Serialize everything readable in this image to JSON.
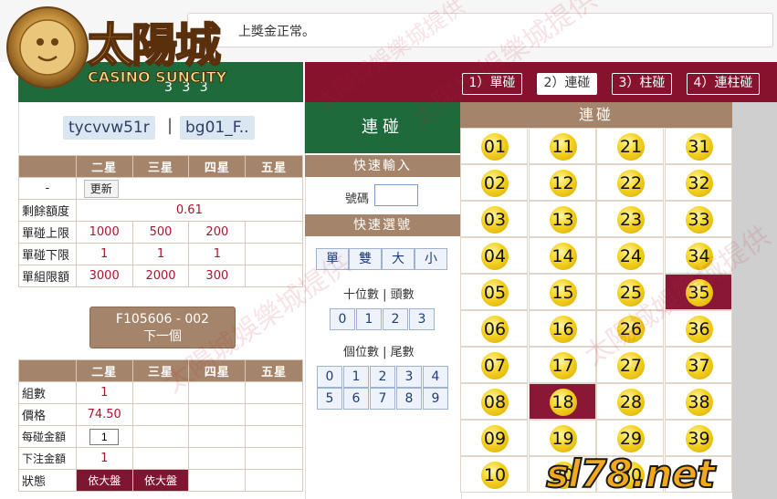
{
  "marquee_text": "上獎金正常。",
  "logo": {
    "brand_cn": "太陽城",
    "brand_en": "CASINO SUNCITY"
  },
  "left_header_code": "3 3 3",
  "play_tabs": [
    {
      "label": "1）單碰"
    },
    {
      "label": "2）連碰"
    },
    {
      "label": "3）柱碰"
    },
    {
      "label": "4）連柱碰"
    }
  ],
  "user": {
    "account": "tycvvw51r",
    "separator": "|",
    "game_id": "bg01_F.."
  },
  "limits_table": {
    "headers": [
      "二星",
      "三星",
      "四星",
      "五星"
    ],
    "refresh_row": {
      "label": "-",
      "button": "更新"
    },
    "balance": {
      "label": "剩餘額度",
      "value": "0.61"
    },
    "rows": [
      {
        "label": "單碰上限",
        "values": [
          "1000",
          "500",
          "200",
          ""
        ]
      },
      {
        "label": "單碰下限",
        "values": [
          "1",
          "1",
          "1",
          ""
        ]
      },
      {
        "label": "單組限額",
        "values": [
          "3000",
          "2000",
          "300",
          ""
        ]
      }
    ]
  },
  "next_button": {
    "line1": "F105606 - 002",
    "line2": "下一個"
  },
  "bet_table": {
    "headers": [
      "二星",
      "三星",
      "四星",
      "五星"
    ],
    "groups": {
      "label": "組數",
      "value": "1"
    },
    "price": {
      "label": "價格",
      "value": "74.50"
    },
    "per_bet": {
      "label": "每碰金額",
      "value": "1"
    },
    "total": {
      "label": "下注金額",
      "value": "1"
    },
    "status": {
      "label": "狀態",
      "values": [
        "依大盤",
        "依大盤"
      ]
    }
  },
  "middle": {
    "title": "連碰",
    "quick_input": "快速輸入",
    "number_label": "號碼",
    "number_value": "",
    "quick_select": "快速選號",
    "parity_buttons": [
      "單",
      "雙",
      "大",
      "小"
    ],
    "tens_label": "十位數 | 頭數",
    "tens_buttons": [
      "0",
      "1",
      "2",
      "3"
    ],
    "units_label": "個位數 | 尾數",
    "units_buttons": [
      "0",
      "1",
      "2",
      "3",
      "4",
      "5",
      "6",
      "7",
      "8",
      "9"
    ]
  },
  "grid": {
    "title": "連碰",
    "columns": [
      [
        "01",
        "02",
        "03",
        "04",
        "05",
        "06",
        "07",
        "08",
        "09",
        "10"
      ],
      [
        "11",
        "12",
        "13",
        "14",
        "15",
        "16",
        "17",
        "18",
        "19",
        "20"
      ],
      [
        "21",
        "22",
        "23",
        "24",
        "25",
        "26",
        "27",
        "28",
        "29",
        "30"
      ],
      [
        "31",
        "32",
        "33",
        "34",
        "35",
        "36",
        "37",
        "38",
        "39",
        ""
      ]
    ],
    "selected": [
      "18",
      "35"
    ]
  },
  "watermark": "太陽城娛樂城提供",
  "site_mark": "sl78.net",
  "colors": {
    "green": "#1f6a3a",
    "maroon": "#86122e",
    "tan": "#a4846a",
    "ball": "#f5d21e"
  }
}
